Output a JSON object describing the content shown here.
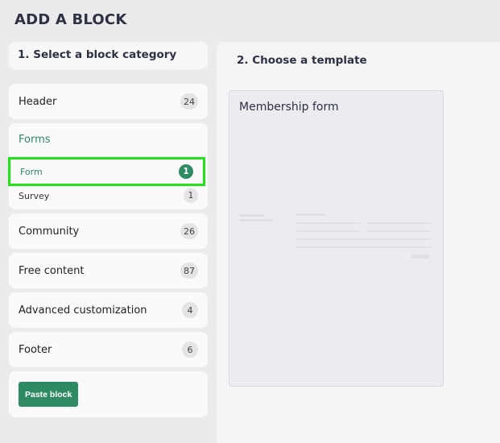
{
  "page": {
    "title": "ADD A BLOCK"
  },
  "left": {
    "header": "1. Select a block category",
    "categories": [
      {
        "label": "Header",
        "count": "24"
      },
      {
        "label": "Community",
        "count": "26"
      },
      {
        "label": "Free content",
        "count": "87"
      },
      {
        "label": "Advanced customization",
        "count": "4"
      },
      {
        "label": "Footer",
        "count": "6"
      }
    ],
    "forms": {
      "label": "Forms",
      "subitems": [
        {
          "label": "Form",
          "count": "1",
          "selected": true
        },
        {
          "label": "Survey",
          "count": "1",
          "selected": false
        }
      ]
    },
    "paste_label": "Paste block"
  },
  "right": {
    "header": "2. Choose a template",
    "templates": [
      {
        "name": "Membership form"
      }
    ]
  },
  "colors": {
    "accent": "#2e8a63",
    "highlight": "#22e31a",
    "background": "#ebebed"
  }
}
